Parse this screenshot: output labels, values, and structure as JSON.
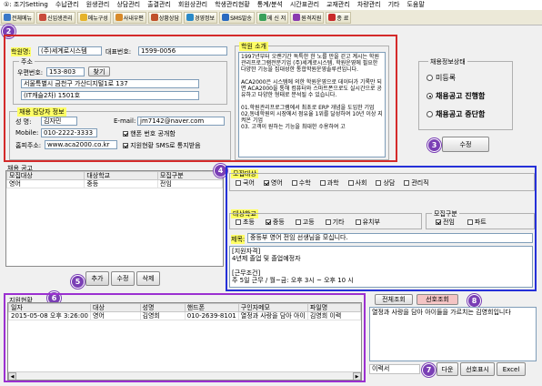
{
  "menu": [
    "①: 조기Setting",
    "수납관리",
    "원생관리",
    "상담관리",
    "출결관리",
    "회원상관리",
    "학생관리현황",
    "통계/분석",
    "시간표관리",
    "교재관리",
    "차량관리",
    "기타",
    "도움말"
  ],
  "toolbar": [
    {
      "label": "전체메뉴",
      "color": "#3a78c8"
    },
    {
      "label": "신입생관리",
      "color": "#c84a3a"
    },
    {
      "label": "메뉴구성",
      "color": "#e6b32a"
    },
    {
      "label": "사내우편",
      "color": "#d88a2a"
    },
    {
      "label": "상황상담",
      "color": "#c0502a"
    },
    {
      "label": "경영정보",
      "color": "#2a8ac8"
    },
    {
      "label": "SMS발송",
      "color": "#2a6ac0"
    },
    {
      "label": "메 신 저",
      "color": "#3aa05a"
    },
    {
      "label": "원격지원",
      "color": "#8a3ab0"
    },
    {
      "label": "종 료",
      "color": "#c82a2a"
    }
  ],
  "badges": {
    "b2": "2",
    "b3": "3",
    "b4": "4",
    "b5": "5",
    "b6": "6",
    "b7": "7",
    "b8": "8"
  },
  "academy": {
    "name_label": "학원명:",
    "name": "(주)세계로시스템",
    "phone_label": "대표번호:",
    "phone": "1599-0056",
    "address_label": "주소",
    "zip_label": "우편번호:",
    "zip": "153-803",
    "find_button": "찾기",
    "address1": "서울특별시 금천구 가산디지털1로 137",
    "address2": "(IT캐슬2차) 1501호"
  },
  "manager": {
    "section_label": "채용 담당자 정보",
    "name_label": "성  명:",
    "name": "김자민",
    "email_label": "E-mail:",
    "email": "jm7142@naver.com",
    "mobile_label": "Mobile:",
    "mobile": "010-2222-3333",
    "public_label": "핸폰 번호 공개함",
    "homepage_label": "홈피주소:",
    "homepage": "www.aca2000.co.kr",
    "sms_label": "지원현황 SMS로 통지받음"
  },
  "intro": {
    "label": "학원 소개",
    "text": "1997년부터 오랜기간 독특한 한 노를 만을 걷고 계시는 학원관리프로그램전문기업 (주)세계로시스템. 학원운영에 필요한 다양한 기능을 집대성한 통합학원운영솔루션입니다.\n\nACA2000은 시스템에 의한 학원운영으로 데이터가 기록만 되면 ACA2000을 통해 컴퓨터와 스마트폰으로도 실시간으로 공유하고 다양한 형태로 분석될 수 있습니다.\n\n01.학원관리프로그램에서 최초로 ERP 개념을 도입한 기업\n02.동네학원의 시장에서 점유율 1위를 달성하여 10년 이상 지켜온 기업\n03. 고객이 원하는 기능을 최대한 수용하여 고"
  },
  "status": {
    "group_label": "채용정보상태",
    "options": [
      "미등록",
      "채용공고 진행함",
      "채용공고 중단함"
    ],
    "selected": 1,
    "edit_button": "수정"
  },
  "jobs": {
    "label": "채용 공고",
    "columns": [
      "모집대상",
      "대상학교",
      "모집구분"
    ],
    "rows": [
      [
        "영어",
        "중등",
        "전임"
      ]
    ],
    "add_button": "추가",
    "edit_button": "수정",
    "delete_button": "삭제"
  },
  "detail": {
    "target_label": "모집대상",
    "subjects": [
      {
        "label": "국어",
        "checked": false
      },
      {
        "label": "영어",
        "checked": true
      },
      {
        "label": "수학",
        "checked": false
      },
      {
        "label": "과학",
        "checked": false
      },
      {
        "label": "사회",
        "checked": false
      },
      {
        "label": "상담",
        "checked": false
      },
      {
        "label": "관리직",
        "checked": false
      }
    ],
    "school_label": "대상학교",
    "schools": [
      {
        "label": "초등",
        "checked": false
      },
      {
        "label": "중등",
        "checked": true
      },
      {
        "label": "고등",
        "checked": false
      },
      {
        "label": "기타",
        "checked": false
      },
      {
        "label": "유치부",
        "checked": false
      }
    ],
    "type_label": "모집구분",
    "types": [
      {
        "label": "전임",
        "checked": true
      },
      {
        "label": "파트",
        "checked": false
      }
    ],
    "title_label": "제목:",
    "title": "중등부 영어 전임 선생님을 모십니다.",
    "body": "[지원자격]\n4년제 졸업 및 졸업예정자\n\n[근무조건]\n주 5일 근무 / 월~금: 오후 3시 ~ 오후 10 시"
  },
  "applicants": {
    "label": "지원현황",
    "columns": [
      "일자",
      "대상",
      "성명",
      "핸드폰",
      "구인자메모",
      "파일명"
    ],
    "rows": [
      [
        "2015-05-08 오후 3:26:00",
        "영어",
        "김영희",
        "010-2639-8101",
        "열정과 사랑을 담아 아이",
        "김영희 이력"
      ]
    ],
    "tab_all": "전체조회",
    "tab_pref": "선호조회",
    "memo": "열정과 사랑을 담아 아이들을 가르치는 김영희입니다",
    "file": "이력서",
    "download_button": "다운",
    "pref_button": "선호표시",
    "excel_button": "Excel"
  }
}
